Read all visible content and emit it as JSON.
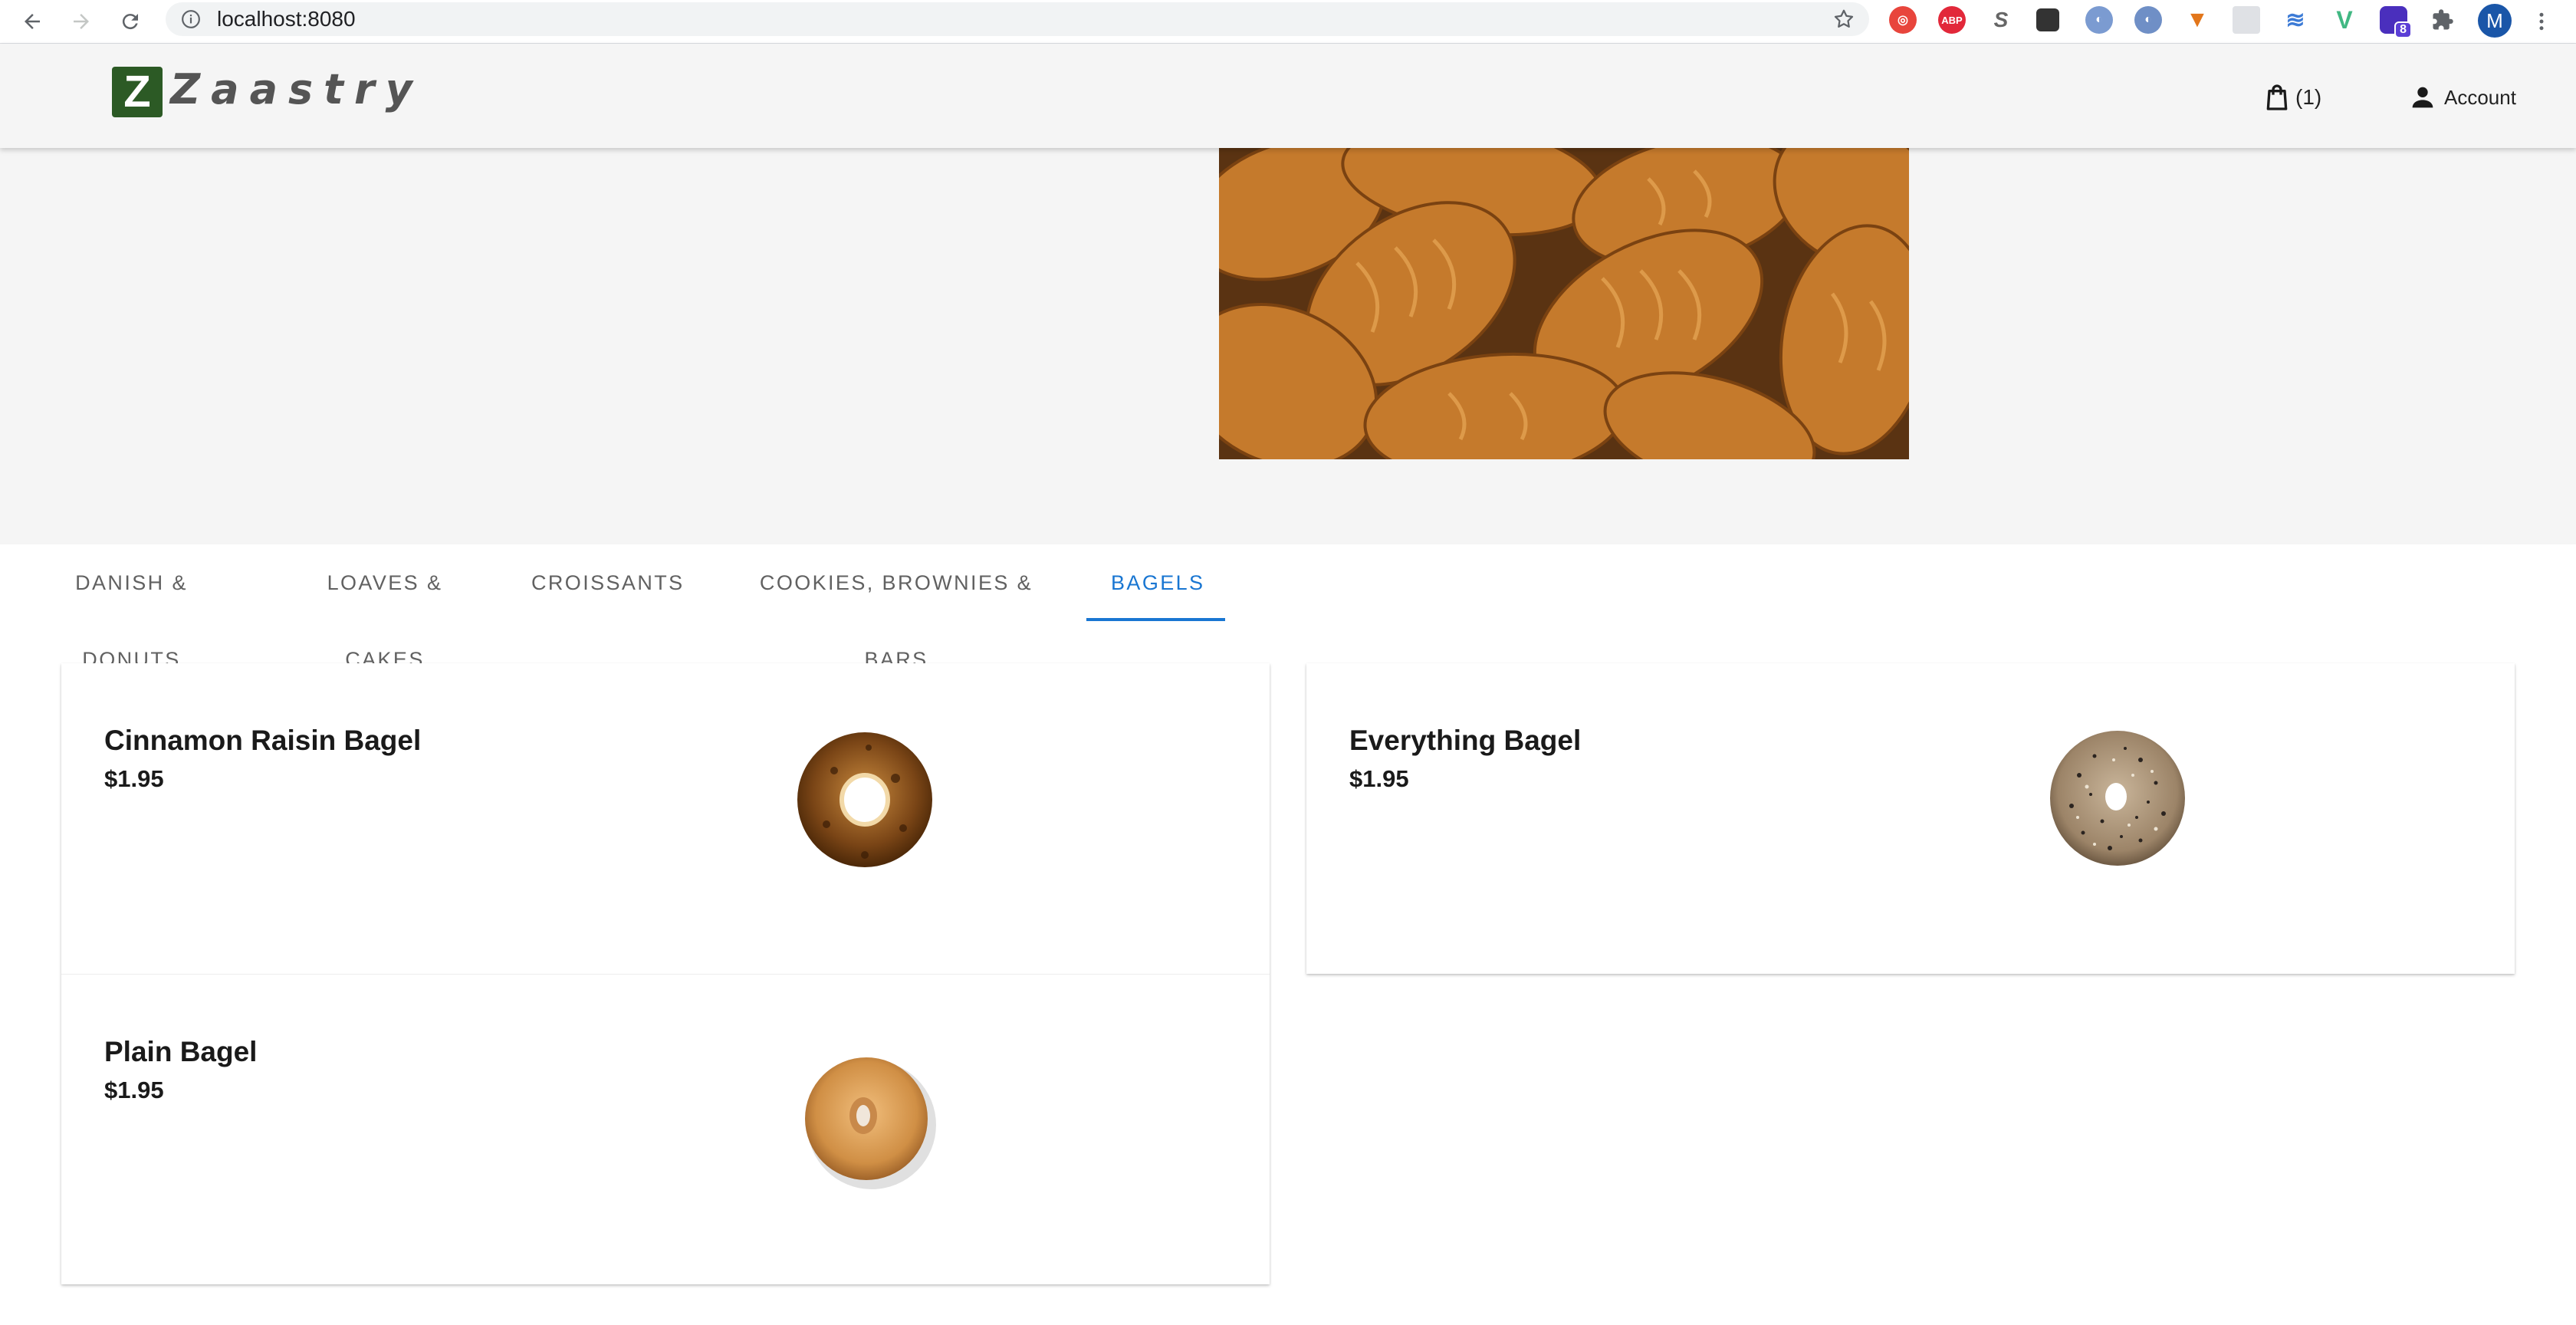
{
  "browser": {
    "url": "localhost:8080",
    "extensions": [
      "ghostery",
      "adblock-plus",
      "s-extension",
      "pocket",
      "ext-blue-1",
      "ext-blue-2",
      "metamask",
      "ext-grid",
      "ext-layers",
      "vue-devtools",
      "ext-badge",
      "puzzle"
    ],
    "extension_badge": "8",
    "profile_initial": "M"
  },
  "header": {
    "logo_letter": "Z",
    "logo_text": "Zaastry",
    "cart_count": "(1)",
    "account_label": "Account"
  },
  "hero": {
    "image": "croissants-photo"
  },
  "tabs": [
    {
      "label": "DANISH & DONUTS",
      "active": false
    },
    {
      "label": "LOAVES & CAKES",
      "active": false
    },
    {
      "label": "CROISSANTS",
      "active": false
    },
    {
      "label": "COOKIES, BROWNIES & BARS",
      "active": false
    },
    {
      "label": "BAGELS",
      "active": true
    }
  ],
  "products": {
    "left": [
      {
        "name": "Cinnamon Raisin Bagel",
        "price": "$1.95",
        "image": "cinnamon-raisin-bagel"
      },
      {
        "name": "Plain Bagel",
        "price": "$1.95",
        "image": "plain-bagel"
      }
    ],
    "right": [
      {
        "name": "Everything Bagel",
        "price": "$1.95",
        "image": "everything-bagel"
      }
    ]
  },
  "colors": {
    "accent": "#1976d2",
    "logo_green": "#2c5a25",
    "header_bg": "#f5f5f5"
  }
}
